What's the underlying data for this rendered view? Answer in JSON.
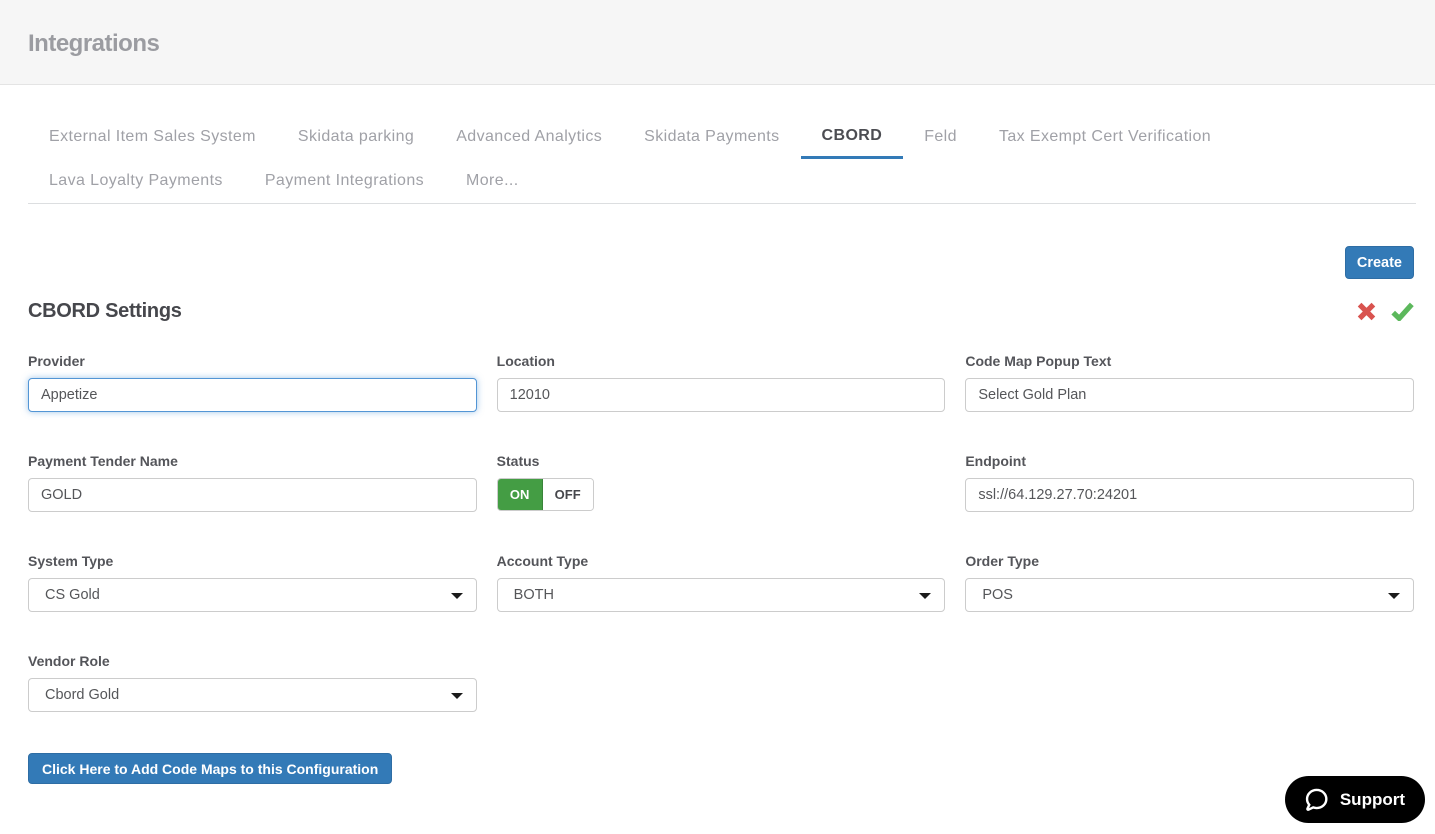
{
  "header": {
    "title": "Integrations"
  },
  "tabs": [
    {
      "label": "External Item Sales System",
      "active": false
    },
    {
      "label": "Skidata parking",
      "active": false
    },
    {
      "label": "Advanced Analytics",
      "active": false
    },
    {
      "label": "Skidata Payments",
      "active": false
    },
    {
      "label": "CBORD",
      "active": true
    },
    {
      "label": "Feld",
      "active": false
    },
    {
      "label": "Tax Exempt Cert Verification",
      "active": false
    },
    {
      "label": "Lava Loyalty Payments",
      "active": false
    },
    {
      "label": "Payment Integrations",
      "active": false
    },
    {
      "label": "More...",
      "active": false
    }
  ],
  "toolbar": {
    "create_label": "Create"
  },
  "section": {
    "title": "CBORD Settings"
  },
  "form": {
    "provider": {
      "label": "Provider",
      "value": "Appetize"
    },
    "location": {
      "label": "Location",
      "value": "12010"
    },
    "code_map_popup_text": {
      "label": "Code Map Popup Text",
      "value": "Select Gold Plan"
    },
    "payment_tender_name": {
      "label": "Payment Tender Name",
      "value": "GOLD"
    },
    "status": {
      "label": "Status",
      "on_label": "ON",
      "off_label": "OFF",
      "value": "ON"
    },
    "endpoint": {
      "label": "Endpoint",
      "value": "ssl://64.129.27.70:24201"
    },
    "system_type": {
      "label": "System Type",
      "value": "CS Gold"
    },
    "account_type": {
      "label": "Account Type",
      "value": "BOTH"
    },
    "order_type": {
      "label": "Order Type",
      "value": "POS"
    },
    "vendor_role": {
      "label": "Vendor Role",
      "value": "Cbord Gold"
    }
  },
  "actions": {
    "add_code_maps_label": "Click Here to Add Code Maps to this Configuration"
  },
  "support": {
    "label": "Support"
  },
  "colors": {
    "accent_blue": "#337ab7",
    "toggle_green": "#449d44",
    "cancel_red": "#d9534f",
    "confirm_green": "#5cb85c",
    "header_bg": "#f6f6f6"
  }
}
